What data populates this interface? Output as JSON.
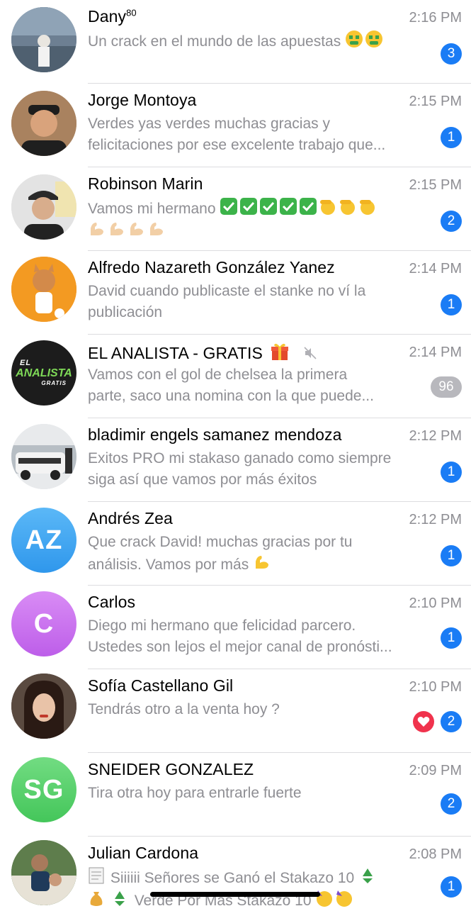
{
  "chats": [
    {
      "name": "Dany",
      "name_sup": "80",
      "time": "2:16 PM",
      "lines": [
        "Un crack en el mundo de las apuestas"
      ],
      "emoji_suffix": [
        "money-mouth-emoji",
        "money-mouth-emoji"
      ],
      "badge": "3",
      "avatar_initials": "",
      "avatar_color": "#6d7f92"
    },
    {
      "name": "Jorge Montoya",
      "time": "2:15 PM",
      "lines": [
        "Verdes yas verdes muchas gracias y",
        "felicitaciones por ese excelente trabajo que..."
      ],
      "badge": "1",
      "avatar_initials": "",
      "avatar_color": "#7a5a44"
    },
    {
      "name": "Robinson Marin",
      "time": "2:15 PM",
      "lines": [
        "Vamos mi hermano"
      ],
      "badge": "2",
      "avatar_initials": "",
      "avatar_color": "#c9c9c9"
    },
    {
      "name": "Alfredo Nazareth González Yanez",
      "time": "2:14 PM",
      "lines": [
        "David cuando publicaste el stanke no ví la",
        "publicación"
      ],
      "badge": "1",
      "avatar_initials": "",
      "avatar_color": "#f28a16"
    },
    {
      "name": "EL ANALISTA - GRATIS",
      "time": "2:14 PM",
      "lines": [
        "Vamos con el gol de chelsea la primera",
        "parte, saco una nomina con la que puede..."
      ],
      "badge": "96",
      "badge_muted": true,
      "avatar_text_1": "EL",
      "avatar_text_2": "ANALISTA",
      "avatar_text_3": "GRATIS",
      "avatar_color": "#1c1c1c"
    },
    {
      "name": "bladimir engels samanez mendoza",
      "time": "2:12 PM",
      "lines": [
        "Exitos PRO mi stakaso ganado como siempre",
        "siga así que vamos por más éxitos"
      ],
      "badge": "1",
      "avatar_initials": "",
      "avatar_color": "#9aa3ab"
    },
    {
      "name": "Andrés Zea",
      "time": "2:12 PM",
      "lines": [
        "Que crack David! muchas gracias por tu",
        "análisis. Vamos por más"
      ],
      "badge": "1",
      "avatar_initials": "AZ",
      "avatar_color": "#42a9f0"
    },
    {
      "name": "Carlos",
      "time": "2:10 PM",
      "lines": [
        "Diego mi hermano que felicidad parcero.",
        "Ustedes son lejos el mejor canal de pronósti..."
      ],
      "badge": "1",
      "avatar_initials": "C",
      "avatar_color": "#c86bf0"
    },
    {
      "name": "Sofía Castellano Gil",
      "time": "2:10 PM",
      "lines": [
        "Tendrás otro a la venta hoy ?"
      ],
      "badge": "2",
      "avatar_initials": "",
      "avatar_color": "#3b2a24"
    },
    {
      "name": "SNEIDER GONZALEZ",
      "time": "2:09 PM",
      "lines": [
        "Tira otra hoy para entrarle fuerte"
      ],
      "badge": "2",
      "avatar_initials": "SG",
      "avatar_color": "#56d06a"
    },
    {
      "name": "Julian Cardona",
      "time": "2:08 PM",
      "lines": [
        "Siiiiii Señores se Ganó el Stakazo 10",
        "Verde Por Más Stakazo 10"
      ],
      "badge": "1",
      "avatar_initials": "",
      "avatar_color": "#4d6b3f"
    }
  ],
  "colors": {
    "badge_blue": "#1a7cf5",
    "badge_muted": "#b8b8bd",
    "reaction_red": "#f0334d",
    "secondary_text": "#8e8e93"
  }
}
